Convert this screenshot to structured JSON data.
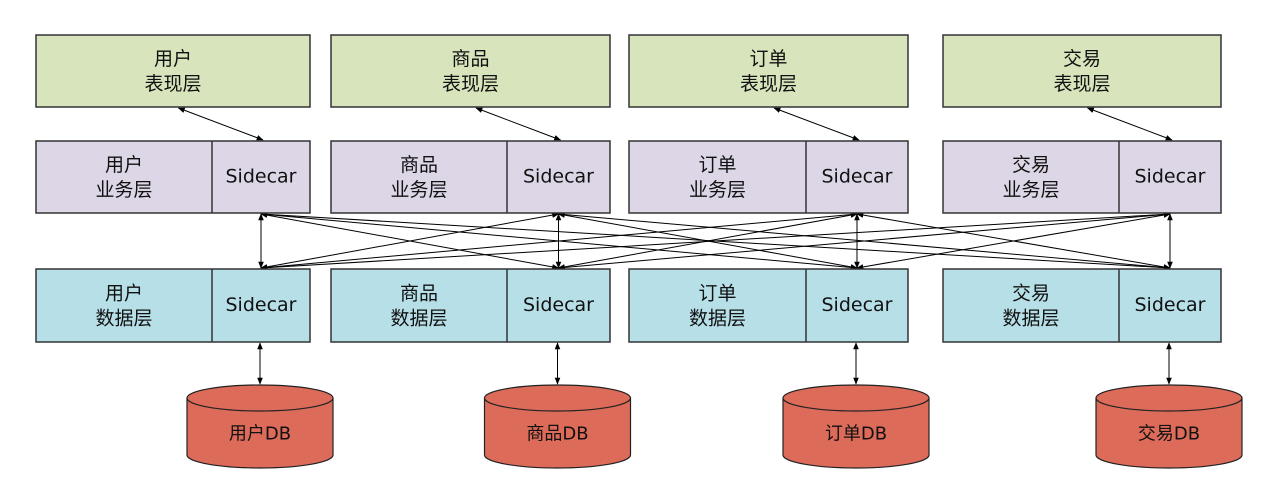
{
  "colors": {
    "presentation_fill": "#d8e4bc",
    "business_fill": "#dcd6e6",
    "data_fill": "#b7dfe8",
    "db_fill": "#dd6b5a",
    "box_stroke": "#333333",
    "db_stroke": "#222222",
    "arrow": "#000000"
  },
  "columns": [
    {
      "id": "user",
      "presentation": [
        "用户",
        "表现层"
      ],
      "business": [
        "用户",
        "业务层"
      ],
      "data": [
        "用户",
        "数据层"
      ],
      "sidecar": "Sidecar",
      "db": "用户DB"
    },
    {
      "id": "product",
      "presentation": [
        "商品",
        "表现层"
      ],
      "business": [
        "商品",
        "业务层"
      ],
      "data": [
        "商品",
        "数据层"
      ],
      "sidecar": "Sidecar",
      "db": "商品DB"
    },
    {
      "id": "order",
      "presentation": [
        "订单",
        "表现层"
      ],
      "business": [
        "订单",
        "业务层"
      ],
      "data": [
        "订单",
        "数据层"
      ],
      "sidecar": "Sidecar",
      "db": "订单DB"
    },
    {
      "id": "trade",
      "presentation": [
        "交易",
        "表现层"
      ],
      "business": [
        "交易",
        "业务层"
      ],
      "data": [
        "交易",
        "数据层"
      ],
      "sidecar": "Sidecar",
      "db": "交易DB"
    }
  ]
}
